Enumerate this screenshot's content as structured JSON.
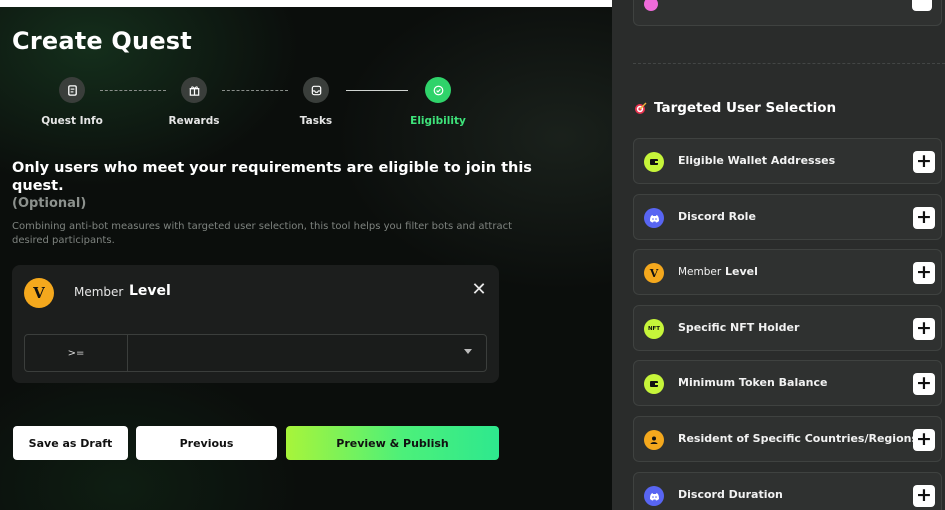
{
  "page": {
    "title": "Create Quest"
  },
  "steps": [
    {
      "label": "Quest Info",
      "icon": "document-icon",
      "state": "done"
    },
    {
      "label": "Rewards",
      "icon": "gift-icon",
      "state": "done"
    },
    {
      "label": "Tasks",
      "icon": "tasks-icon",
      "state": "done"
    },
    {
      "label": "Eligibility",
      "icon": "check-circle-icon",
      "state": "active"
    }
  ],
  "intro": {
    "main": "Only users who meet your requirements are eligible to join this quest.",
    "optional": "(Optional)",
    "description": "Combining anti-bot measures with targeted user selection, this tool helps you filter bots and attract desired participants."
  },
  "condition_card": {
    "icon_letter": "V",
    "member_text": "Member",
    "level_text": "Level",
    "operator": ">=",
    "value": ""
  },
  "buttons": {
    "save_draft": "Save as Draft",
    "previous": "Previous",
    "publish": "Preview & Publish"
  },
  "sidebar": {
    "section_title": "Targeted User Selection",
    "items": [
      {
        "label": "Eligible Wallet Addresses",
        "icon": "wallet-icon"
      },
      {
        "label": "Discord Role",
        "icon": "discord-icon"
      },
      {
        "label_prefix": "Member",
        "label": "Level",
        "icon": "v-badge-icon",
        "icon_letter": "V"
      },
      {
        "label": "Specific NFT Holder",
        "icon": "nft-icon",
        "icon_text": "NFT"
      },
      {
        "label": "Minimum Token Balance",
        "icon": "token-icon"
      },
      {
        "label": "Resident of Specific Countries/Regions",
        "icon": "location-icon"
      },
      {
        "label": "Discord Duration",
        "icon": "discord-icon"
      }
    ]
  },
  "colors": {
    "accent_green": "#2fd36a",
    "publish_gradient_start": "#a8f43a",
    "publish_gradient_end": "#2ee88e",
    "level_badge": "#f4a81d",
    "discord": "#5865f2",
    "wallet_token": "#c6f53a"
  }
}
